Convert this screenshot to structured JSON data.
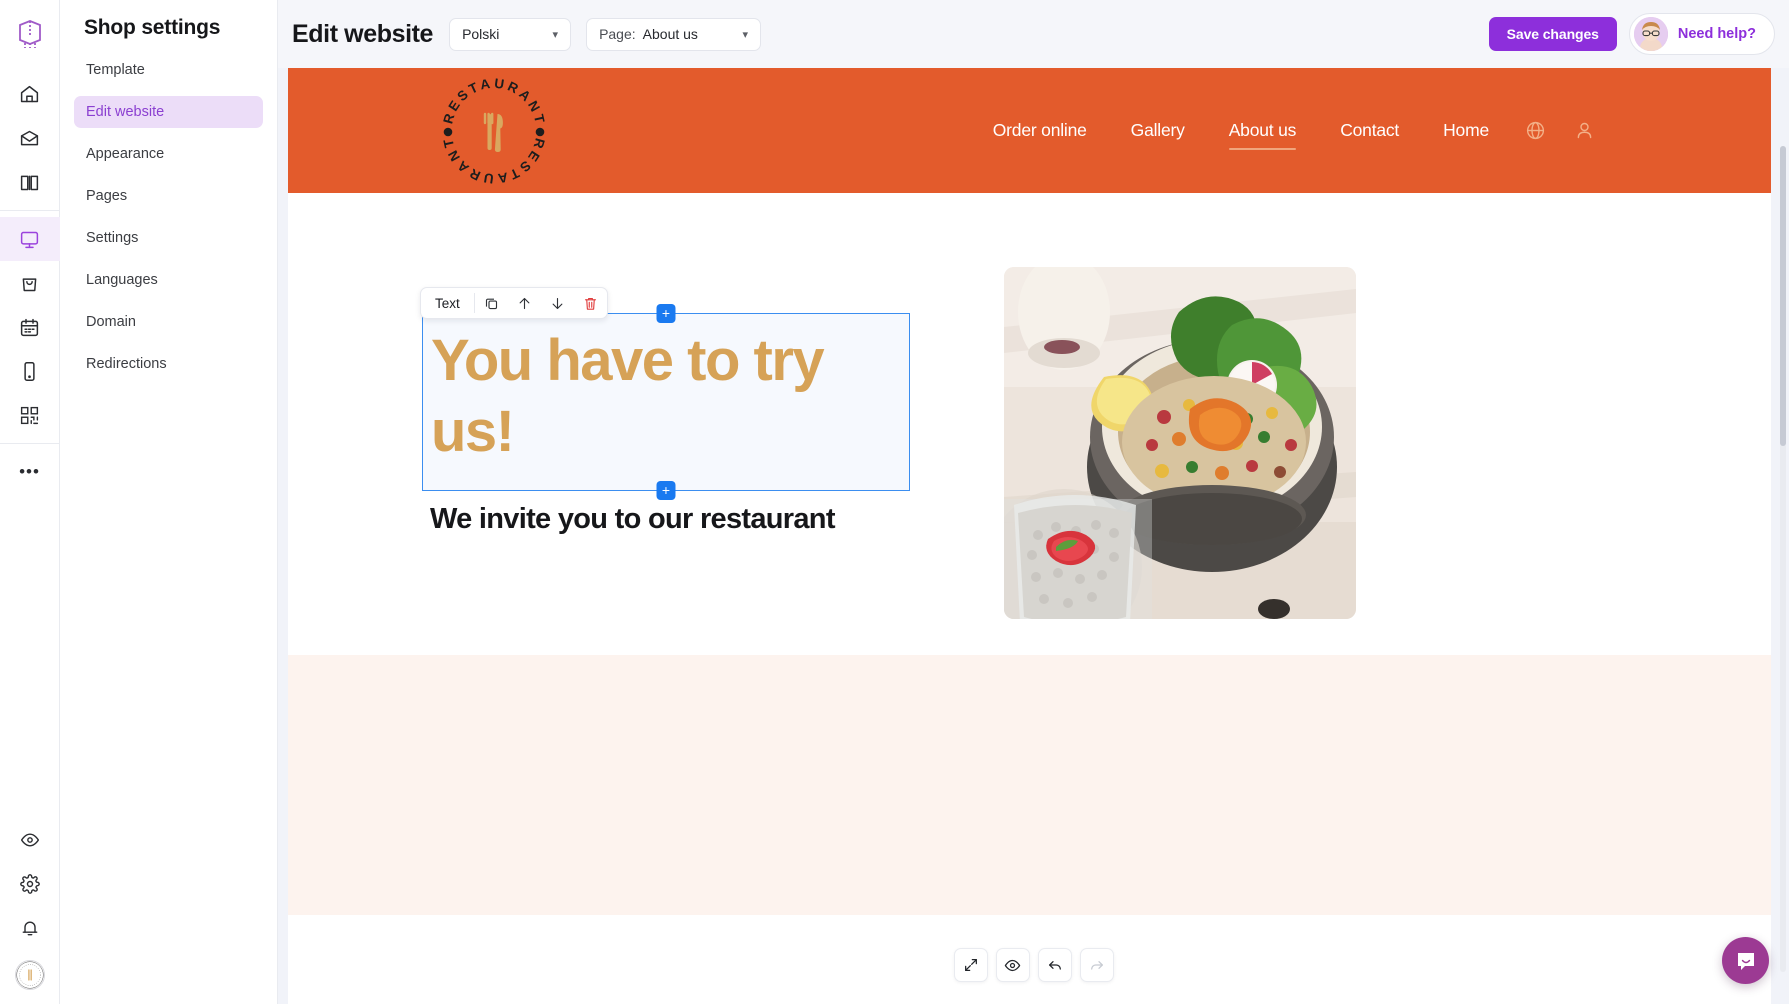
{
  "rail": {
    "logo_icon": "book-logo-icon",
    "items": [
      {
        "name": "home-icon"
      },
      {
        "name": "inbox-icon"
      },
      {
        "name": "book-icon"
      },
      {
        "name": "monitor-icon",
        "active": true
      },
      {
        "name": "bag-icon"
      },
      {
        "name": "calendar-icon"
      },
      {
        "name": "mobile-icon"
      },
      {
        "name": "qr-code-icon"
      }
    ],
    "more_label": "•••",
    "bottom": [
      {
        "name": "eye-icon"
      },
      {
        "name": "gear-icon"
      },
      {
        "name": "bell-icon"
      }
    ],
    "avatar_name": "restaurant-avatar"
  },
  "sidebar": {
    "title": "Shop settings",
    "items": [
      {
        "label": "Template",
        "active": false
      },
      {
        "label": "Edit website",
        "active": true
      },
      {
        "label": "Appearance",
        "active": false
      },
      {
        "label": "Pages",
        "active": false
      },
      {
        "label": "Settings",
        "active": false
      },
      {
        "label": "Languages",
        "active": false
      },
      {
        "label": "Domain",
        "active": false
      },
      {
        "label": "Redirections",
        "active": false
      }
    ]
  },
  "topbar": {
    "title": "Edit website",
    "language_value": "Polski",
    "page_prefix": "Page:",
    "page_value": "About us",
    "save_label": "Save changes",
    "help_label": "Need help?"
  },
  "site": {
    "logo_text": "RESTAURANT",
    "nav": [
      {
        "label": "Order online",
        "active": false
      },
      {
        "label": "Gallery",
        "active": false
      },
      {
        "label": "About us",
        "active": true
      },
      {
        "label": "Contact",
        "active": false
      },
      {
        "label": "Home",
        "active": false
      }
    ],
    "nav_icons": [
      {
        "name": "globe-icon"
      },
      {
        "name": "user-icon"
      }
    ],
    "heading": "You have to try us!",
    "subheading": "We invite you to our restaurant",
    "image_alt": "quinoa-salad-bowl-photo"
  },
  "editor": {
    "toolbar_label": "Text",
    "tools": [
      {
        "name": "duplicate-icon"
      },
      {
        "name": "move-up-icon"
      },
      {
        "name": "move-down-icon"
      },
      {
        "name": "delete-icon"
      }
    ],
    "add_block_label": "+",
    "bottom_tools": [
      {
        "name": "expand-icon",
        "disabled": false
      },
      {
        "name": "preview-eye-icon",
        "disabled": false
      },
      {
        "name": "undo-icon",
        "disabled": false
      },
      {
        "name": "redo-icon",
        "disabled": true
      }
    ]
  },
  "colors": {
    "accent_purple": "#8d2fdb",
    "brand_orange": "#e35b2c",
    "heading_gold": "#d6a257",
    "selection_blue": "#3b8ef0",
    "footer_cream": "#fdf3ee"
  },
  "intercom": {
    "name": "intercom-chat-button"
  }
}
